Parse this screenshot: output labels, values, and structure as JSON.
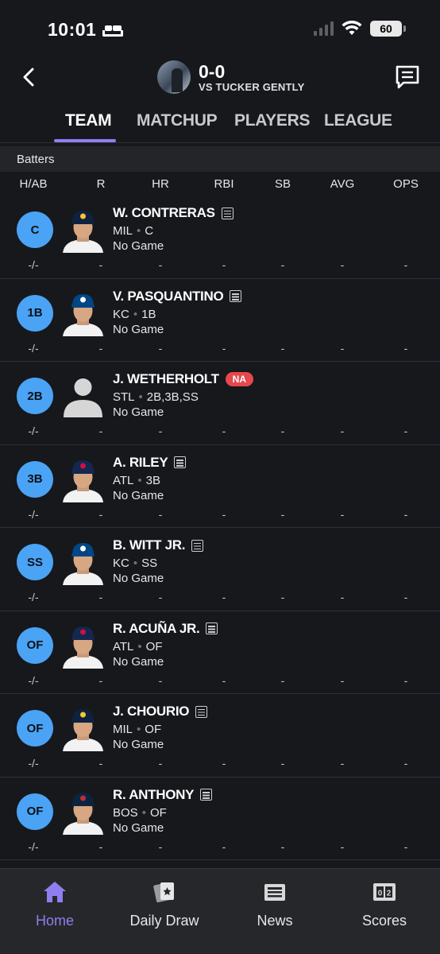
{
  "status_bar": {
    "time": "10:01",
    "battery": "60"
  },
  "header": {
    "score": "0-0",
    "opponent": "VS TUCKER GENTLY"
  },
  "tabs": [
    {
      "label": "TEAM",
      "active": true
    },
    {
      "label": "MATCHUP",
      "active": false
    },
    {
      "label": "PLAYERS",
      "active": false
    },
    {
      "label": "LEAGUE",
      "active": false
    }
  ],
  "section": {
    "title": "Batters"
  },
  "columns": [
    "H/AB",
    "R",
    "HR",
    "RBI",
    "SB",
    "AVG",
    "OPS"
  ],
  "players": [
    {
      "pos": "C",
      "name": "W. CONTRERAS",
      "team": "MIL",
      "elig": "C",
      "game": "No Game",
      "has_note": true,
      "status": "",
      "cap": "brewers",
      "stats": [
        "-/-",
        "-",
        "-",
        "-",
        "-",
        "-",
        "-"
      ]
    },
    {
      "pos": "1B",
      "name": "V. PASQUANTINO",
      "team": "KC",
      "elig": "1B",
      "game": "No Game",
      "has_note": true,
      "status": "",
      "cap": "royals",
      "stats": [
        "-/-",
        "-",
        "-",
        "-",
        "-",
        "-",
        "-"
      ]
    },
    {
      "pos": "2B",
      "name": "J. WETHERHOLT",
      "team": "STL",
      "elig": "2B,3B,SS",
      "game": "No Game",
      "has_note": false,
      "status": "NA",
      "cap": "none",
      "stats": [
        "-/-",
        "-",
        "-",
        "-",
        "-",
        "-",
        "-"
      ]
    },
    {
      "pos": "3B",
      "name": "A. RILEY",
      "team": "ATL",
      "elig": "3B",
      "game": "No Game",
      "has_note": true,
      "status": "",
      "cap": "braves",
      "stats": [
        "-/-",
        "-",
        "-",
        "-",
        "-",
        "-",
        "-"
      ]
    },
    {
      "pos": "SS",
      "name": "B. WITT JR.",
      "team": "KC",
      "elig": "SS",
      "game": "No Game",
      "has_note": true,
      "status": "",
      "cap": "royals",
      "stats": [
        "-/-",
        "-",
        "-",
        "-",
        "-",
        "-",
        "-"
      ]
    },
    {
      "pos": "OF",
      "name": "R. ACUÑA JR.",
      "team": "ATL",
      "elig": "OF",
      "game": "No Game",
      "has_note": true,
      "status": "",
      "cap": "braves",
      "stats": [
        "-/-",
        "-",
        "-",
        "-",
        "-",
        "-",
        "-"
      ]
    },
    {
      "pos": "OF",
      "name": "J. CHOURIO",
      "team": "MIL",
      "elig": "OF",
      "game": "No Game",
      "has_note": true,
      "status": "",
      "cap": "brewers",
      "stats": [
        "-/-",
        "-",
        "-",
        "-",
        "-",
        "-",
        "-"
      ]
    },
    {
      "pos": "OF",
      "name": "R. ANTHONY",
      "team": "BOS",
      "elig": "OF",
      "game": "No Game",
      "has_note": true,
      "status": "",
      "cap": "redsox",
      "stats": [
        "-/-",
        "-",
        "-",
        "-",
        "-",
        "-",
        "-"
      ]
    }
  ],
  "bottom_nav": [
    {
      "label": "Home",
      "icon": "home-icon",
      "active": true
    },
    {
      "label": "Daily Draw",
      "icon": "cards-icon",
      "active": false
    },
    {
      "label": "News",
      "icon": "newspaper-icon",
      "active": false
    },
    {
      "label": "Scores",
      "icon": "scoreboard-icon",
      "active": false
    }
  ],
  "colors": {
    "accent": "#8e7ef0",
    "position_badge": "#4aa3f5",
    "na_badge": "#e5484d",
    "background": "#16181c"
  }
}
